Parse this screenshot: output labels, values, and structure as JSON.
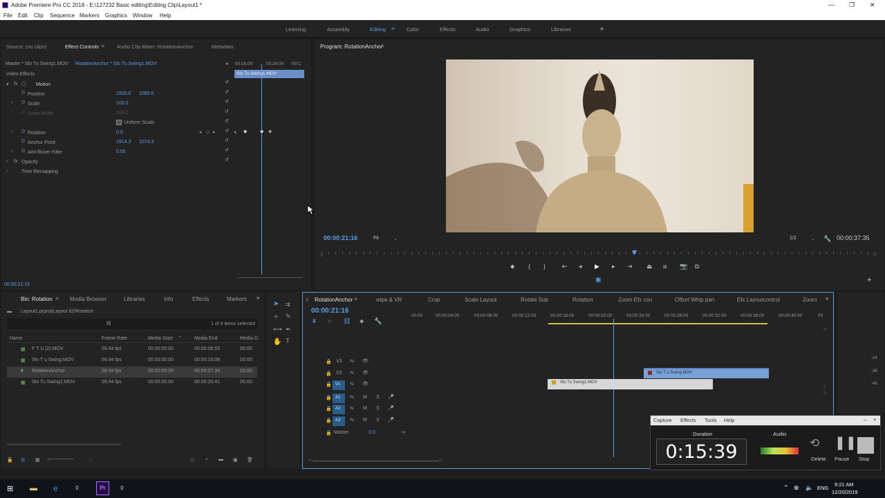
{
  "window": {
    "title": "Adobe Premiere Pro CC 2018 - E:\\127232 Basic editing\\Editing Clip\\Layout1 *",
    "controls": [
      "—",
      "❐",
      "✕"
    ]
  },
  "menu": [
    "File",
    "Edit",
    "Clip",
    "Sequence",
    "Markers",
    "Graphics",
    "Window",
    "Help"
  ],
  "workspaces": [
    "Learning",
    "Assembly",
    "Editing",
    "Color",
    "Effects",
    "Audio",
    "Graphics",
    "Libraries"
  ],
  "workspace_more": "»",
  "source_panel": {
    "tabs": [
      "Source: (no clips)",
      "Effect Controls",
      "Audio Clip Mixer: RotationAnchor",
      "Metadata"
    ],
    "master": "Master * Slo Tu Swing1.MOV",
    "clip": "RotationAnchor * Slo Tu Swing1.MOV",
    "ruler": [
      "00:16:00",
      "00:24:00",
      "00:C"
    ],
    "clip_bar": "Slo Tu Swing1.MOV",
    "video_effects": "Video Effects",
    "params": [
      {
        "name": "Motion",
        "v1": "",
        "v2": ""
      },
      {
        "name": "Position",
        "v1": "1920.0",
        "v2": "1080.0"
      },
      {
        "name": "Scale",
        "v1": "100.0",
        "v2": ""
      },
      {
        "name": "Scale Width",
        "v1": "100.0",
        "v2": ""
      },
      {
        "name": "",
        "v1": "Uniform Scale",
        "v2": ""
      },
      {
        "name": "Rotation",
        "v1": "0.0",
        "v2": ""
      },
      {
        "name": "Anchor Point",
        "v1": "1914.3",
        "v2": "1074.3"
      },
      {
        "name": "Anti-flicker Filter",
        "v1": "0.00",
        "v2": ""
      },
      {
        "name": "Opacity",
        "v1": "",
        "v2": ""
      },
      {
        "name": "Time Remapping",
        "v1": "",
        "v2": ""
      }
    ],
    "timecode": "00:00:21:16"
  },
  "program": {
    "title": "Program: RotationAnchor",
    "timecode": "00:00:21:16",
    "fit": "Fit",
    "resolution": "1/2",
    "duration": "00:00:37:35",
    "playhead_fraction": 0.56
  },
  "project": {
    "tabs": [
      "Bin: Rotation",
      "Media Browser",
      "Libraries",
      "Info",
      "Effects",
      "Markers"
    ],
    "path": "Layout1.prproj\\Layout 62\\Rotation",
    "count": "1 of 4 items selected",
    "columns": [
      "Name",
      "Frame Rate",
      "Media Start",
      "Media End",
      "Media D"
    ],
    "rows": [
      {
        "name": "F T U (2).MOV",
        "fps": "59.94 fps",
        "start": "00:00:00:00",
        "end": "00:00:08:53",
        "dur": "00:00:"
      },
      {
        "name": "Slo T u Swing.MOV",
        "fps": "59.94 fps",
        "start": "00:00:00:00",
        "end": "00:00:16:08",
        "dur": "00:00:"
      },
      {
        "name": "RotationAnchor",
        "fps": "59.94 fps",
        "start": "00:00:00:00",
        "end": "00:00:37:34",
        "dur": "00:00:"
      },
      {
        "name": "Slo Tu Swing1.MOV",
        "fps": "59.94 fps",
        "start": "00:00:00:00",
        "end": "00:00:20:41",
        "dur": "00:00:"
      }
    ]
  },
  "timeline": {
    "tabs": [
      "RotationAnchor",
      "wipe & VR",
      "Crop",
      "Scale Layout",
      "Rotate Sub",
      "Rotation",
      "Zoom Efx con",
      "Offset Whip pan",
      "Efx Layoutcontrol",
      "Zoom"
    ],
    "timecode": "00:00:21:16",
    "ruler": [
      "00:00",
      "00:00:04:00",
      "00:00:08:00",
      "00:00:12:00",
      "00:00:16:00",
      "00:00:20:00",
      "00:00:24:00",
      "00:00:28:00",
      "00:00:32:00",
      "00:00:36:00",
      "00:00:40:00",
      "00"
    ],
    "tracks": [
      "V3",
      "V2",
      "V1",
      "A1",
      "A2",
      "A3"
    ],
    "master": "Master",
    "master_val": "0.0",
    "clips": [
      {
        "name": "Slo T u Swing.MOV",
        "track": "V2"
      },
      {
        "name": "Slo Tu Swing1.MOV",
        "track": "V1"
      }
    ]
  },
  "recorder": {
    "menu": [
      "Capture",
      "Effects",
      "Tools",
      "Help"
    ],
    "duration_label": "Duration",
    "duration": "0:15:39",
    "audio_label": "Audio",
    "buttons": [
      "Delete",
      "Pause",
      "Stop"
    ]
  },
  "taskbar": {
    "time": "9:21 AM",
    "date": "12/20/2019",
    "lang": "ENG"
  }
}
